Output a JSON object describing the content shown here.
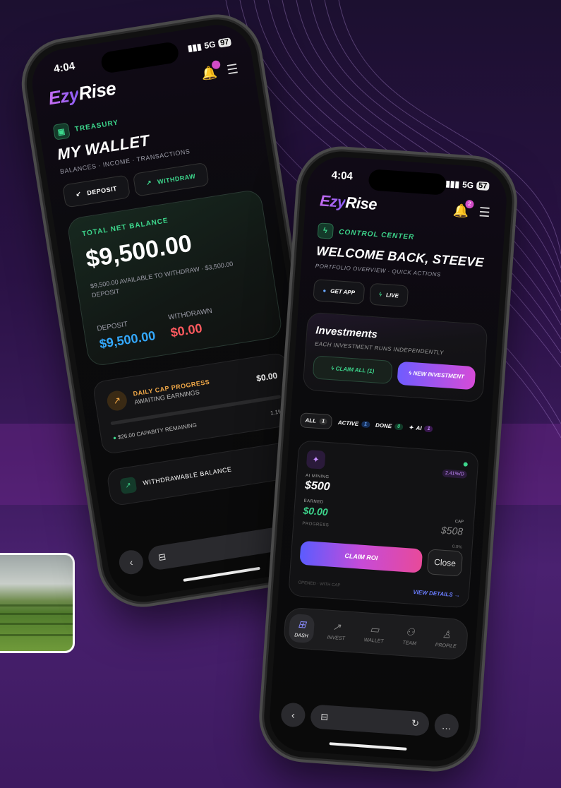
{
  "colors": {
    "accent_green": "#3dd68c",
    "accent_purple": "#c58cff",
    "deposit_blue": "#34a9ff",
    "withdraw_red": "#ff5a5f",
    "background": "#2a1245"
  },
  "phone1": {
    "status": {
      "time": "4:04",
      "network": "5G",
      "battery": "97"
    },
    "app": {
      "logo_prefix": "Ezy",
      "logo_suffix": "Rise"
    },
    "eyebrow": "TREASURY",
    "title": "MY WALLET",
    "subtitle": "BALANCES · INCOME · TRANSACTIONS",
    "buttons": {
      "deposit": "DEPOSIT",
      "withdraw": "WITHDRAW"
    },
    "balance": {
      "label": "TOTAL NET BALANCE",
      "amount": "$9,500.00",
      "note": "$9,500.00 AVAILABLE TO WITHDRAW · $3,500.00 DEPOSIT",
      "deposit_label": "DEPOSIT",
      "deposit_value": "$9,500.00",
      "withdrawn_label": "WITHDRAWN",
      "withdrawn_value": "$0.00"
    },
    "cap": {
      "title": "DAILY CAP PROGRESS",
      "subtitle": "AWAITING EARNINGS",
      "amount": "$0.00",
      "remaining": "$26.00 CAPABITY REMAINING",
      "suffix": "1.1%"
    },
    "withdrawable": "WITHDRAWABLE BALANCE"
  },
  "phone2": {
    "status": {
      "time": "4:04",
      "network": "5G",
      "battery": "57"
    },
    "app": {
      "logo_prefix": "Ezy",
      "logo_suffix": "Rise",
      "bell_count": "2"
    },
    "eyebrow": "CONTROL CENTER",
    "title": "WELCOME BACK, STEEVE",
    "subtitle": "PORTFOLIO OVERVIEW · QUICK ACTIONS",
    "buttons": {
      "get_app": "GET APP",
      "live": "LIVE"
    },
    "investments": {
      "title": "Investments",
      "subtitle": "EACH INVESTMENT RUNS INDEPENDENTLY",
      "claim_all": "CLAIM ALL (1)",
      "new_investment": "NEW INVESTMENT"
    },
    "filters": [
      {
        "label": "ALL",
        "count": "1"
      },
      {
        "label": "ACTIVE",
        "count": "1"
      },
      {
        "label": "DONE",
        "count": "0"
      },
      {
        "label": "AI",
        "count": "1"
      }
    ],
    "card": {
      "badge": "2.41%/D",
      "running_label": "AI MINING",
      "running_value": "$500",
      "earned_label": "EARNED",
      "earned_value": "$0.00",
      "cap_label": "CAP",
      "cap_value": "$508",
      "cap_pct": "0.0%",
      "progress_label": "PROGRESS",
      "claim_roi": "CLAIM ROI",
      "close": "Close",
      "footer_note": "OPENED · WITH CAP",
      "view_details": "VIEW DETAILS →"
    },
    "tabs": [
      "DASH",
      "INVEST",
      "WALLET",
      "TEAM",
      "PROFILE"
    ]
  }
}
